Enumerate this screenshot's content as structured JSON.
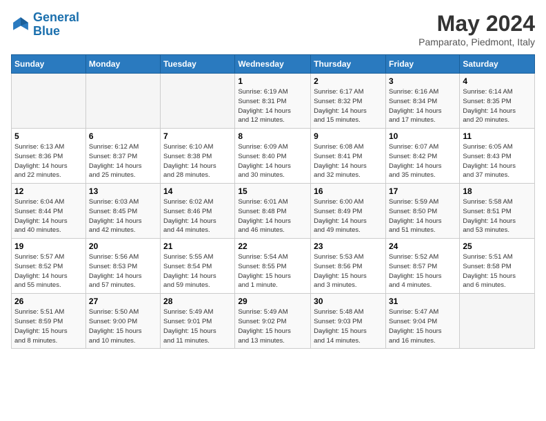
{
  "header": {
    "logo_line1": "General",
    "logo_line2": "Blue",
    "month": "May 2024",
    "location": "Pamparato, Piedmont, Italy"
  },
  "weekdays": [
    "Sunday",
    "Monday",
    "Tuesday",
    "Wednesday",
    "Thursday",
    "Friday",
    "Saturday"
  ],
  "weeks": [
    [
      {
        "day": "",
        "info": ""
      },
      {
        "day": "",
        "info": ""
      },
      {
        "day": "",
        "info": ""
      },
      {
        "day": "1",
        "info": "Sunrise: 6:19 AM\nSunset: 8:31 PM\nDaylight: 14 hours\nand 12 minutes."
      },
      {
        "day": "2",
        "info": "Sunrise: 6:17 AM\nSunset: 8:32 PM\nDaylight: 14 hours\nand 15 minutes."
      },
      {
        "day": "3",
        "info": "Sunrise: 6:16 AM\nSunset: 8:34 PM\nDaylight: 14 hours\nand 17 minutes."
      },
      {
        "day": "4",
        "info": "Sunrise: 6:14 AM\nSunset: 8:35 PM\nDaylight: 14 hours\nand 20 minutes."
      }
    ],
    [
      {
        "day": "5",
        "info": "Sunrise: 6:13 AM\nSunset: 8:36 PM\nDaylight: 14 hours\nand 22 minutes."
      },
      {
        "day": "6",
        "info": "Sunrise: 6:12 AM\nSunset: 8:37 PM\nDaylight: 14 hours\nand 25 minutes."
      },
      {
        "day": "7",
        "info": "Sunrise: 6:10 AM\nSunset: 8:38 PM\nDaylight: 14 hours\nand 28 minutes."
      },
      {
        "day": "8",
        "info": "Sunrise: 6:09 AM\nSunset: 8:40 PM\nDaylight: 14 hours\nand 30 minutes."
      },
      {
        "day": "9",
        "info": "Sunrise: 6:08 AM\nSunset: 8:41 PM\nDaylight: 14 hours\nand 32 minutes."
      },
      {
        "day": "10",
        "info": "Sunrise: 6:07 AM\nSunset: 8:42 PM\nDaylight: 14 hours\nand 35 minutes."
      },
      {
        "day": "11",
        "info": "Sunrise: 6:05 AM\nSunset: 8:43 PM\nDaylight: 14 hours\nand 37 minutes."
      }
    ],
    [
      {
        "day": "12",
        "info": "Sunrise: 6:04 AM\nSunset: 8:44 PM\nDaylight: 14 hours\nand 40 minutes."
      },
      {
        "day": "13",
        "info": "Sunrise: 6:03 AM\nSunset: 8:45 PM\nDaylight: 14 hours\nand 42 minutes."
      },
      {
        "day": "14",
        "info": "Sunrise: 6:02 AM\nSunset: 8:46 PM\nDaylight: 14 hours\nand 44 minutes."
      },
      {
        "day": "15",
        "info": "Sunrise: 6:01 AM\nSunset: 8:48 PM\nDaylight: 14 hours\nand 46 minutes."
      },
      {
        "day": "16",
        "info": "Sunrise: 6:00 AM\nSunset: 8:49 PM\nDaylight: 14 hours\nand 49 minutes."
      },
      {
        "day": "17",
        "info": "Sunrise: 5:59 AM\nSunset: 8:50 PM\nDaylight: 14 hours\nand 51 minutes."
      },
      {
        "day": "18",
        "info": "Sunrise: 5:58 AM\nSunset: 8:51 PM\nDaylight: 14 hours\nand 53 minutes."
      }
    ],
    [
      {
        "day": "19",
        "info": "Sunrise: 5:57 AM\nSunset: 8:52 PM\nDaylight: 14 hours\nand 55 minutes."
      },
      {
        "day": "20",
        "info": "Sunrise: 5:56 AM\nSunset: 8:53 PM\nDaylight: 14 hours\nand 57 minutes."
      },
      {
        "day": "21",
        "info": "Sunrise: 5:55 AM\nSunset: 8:54 PM\nDaylight: 14 hours\nand 59 minutes."
      },
      {
        "day": "22",
        "info": "Sunrise: 5:54 AM\nSunset: 8:55 PM\nDaylight: 15 hours\nand 1 minute."
      },
      {
        "day": "23",
        "info": "Sunrise: 5:53 AM\nSunset: 8:56 PM\nDaylight: 15 hours\nand 3 minutes."
      },
      {
        "day": "24",
        "info": "Sunrise: 5:52 AM\nSunset: 8:57 PM\nDaylight: 15 hours\nand 4 minutes."
      },
      {
        "day": "25",
        "info": "Sunrise: 5:51 AM\nSunset: 8:58 PM\nDaylight: 15 hours\nand 6 minutes."
      }
    ],
    [
      {
        "day": "26",
        "info": "Sunrise: 5:51 AM\nSunset: 8:59 PM\nDaylight: 15 hours\nand 8 minutes."
      },
      {
        "day": "27",
        "info": "Sunrise: 5:50 AM\nSunset: 9:00 PM\nDaylight: 15 hours\nand 10 minutes."
      },
      {
        "day": "28",
        "info": "Sunrise: 5:49 AM\nSunset: 9:01 PM\nDaylight: 15 hours\nand 11 minutes."
      },
      {
        "day": "29",
        "info": "Sunrise: 5:49 AM\nSunset: 9:02 PM\nDaylight: 15 hours\nand 13 minutes."
      },
      {
        "day": "30",
        "info": "Sunrise: 5:48 AM\nSunset: 9:03 PM\nDaylight: 15 hours\nand 14 minutes."
      },
      {
        "day": "31",
        "info": "Sunrise: 5:47 AM\nSunset: 9:04 PM\nDaylight: 15 hours\nand 16 minutes."
      },
      {
        "day": "",
        "info": ""
      }
    ]
  ]
}
